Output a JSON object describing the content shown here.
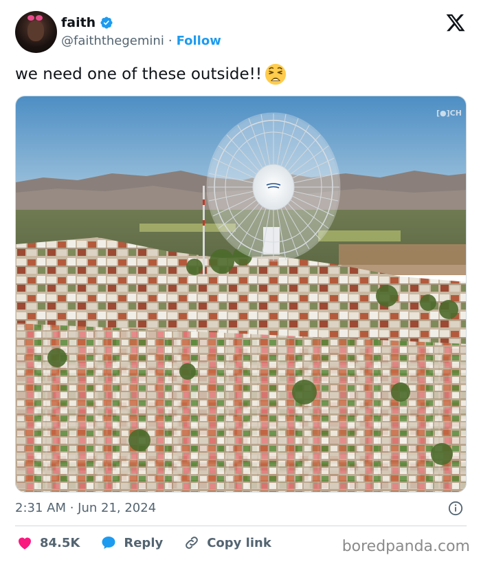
{
  "author": {
    "name": "faith",
    "handle": "@faiththegemini",
    "separator": "·",
    "follow_label": "Follow",
    "verified": true
  },
  "tweet": {
    "text": "we need one of these outside!!",
    "emoji": "weary-face-emoji",
    "media_watermark": "[●]CH",
    "timestamp": "2:31 AM · Jun 21, 2024"
  },
  "actions": {
    "likes": "84.5K",
    "reply_label": "Reply",
    "copy_link_label": "Copy link"
  },
  "watermark": "boredpanda.com",
  "colors": {
    "accent": "#1d9bf0",
    "like": "#f91880",
    "text_secondary": "#536471"
  },
  "icons": [
    "verified-badge-icon",
    "x-logo-icon",
    "info-icon",
    "heart-icon",
    "reply-bubble-icon",
    "link-icon"
  ]
}
